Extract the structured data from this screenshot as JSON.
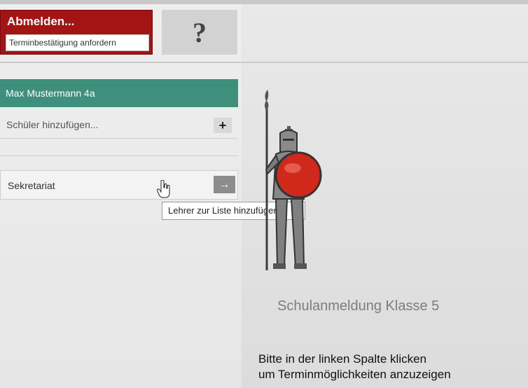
{
  "header": {
    "logout_label": "Abmelden...",
    "confirm_label": "Terminbestätigung anfordern",
    "help_label": "?"
  },
  "sidebar": {
    "selected_student": "Max Mustermann 4a",
    "add_student_placeholder": "Schüler hinzufügen...",
    "add_student_button": "+",
    "teacher_entry": "Sekretariat",
    "teacher_add_button": "→",
    "tooltip": "Lehrer zur Liste hinzufügen"
  },
  "main": {
    "title": "Schulanmeldung Klasse 5",
    "instruction_line1": "Bitte in der linken Spalte klicken",
    "instruction_line2": "um Terminmöglichkeiten anzuzeigen"
  },
  "colors": {
    "logout_bg": "#a31414",
    "selected_bg": "#3f8f7d",
    "shield": "#d0281b"
  },
  "icons": {
    "mascot": "knight-mascot-icon",
    "cursor": "hand-cursor-icon",
    "help": "question-mark-icon"
  }
}
